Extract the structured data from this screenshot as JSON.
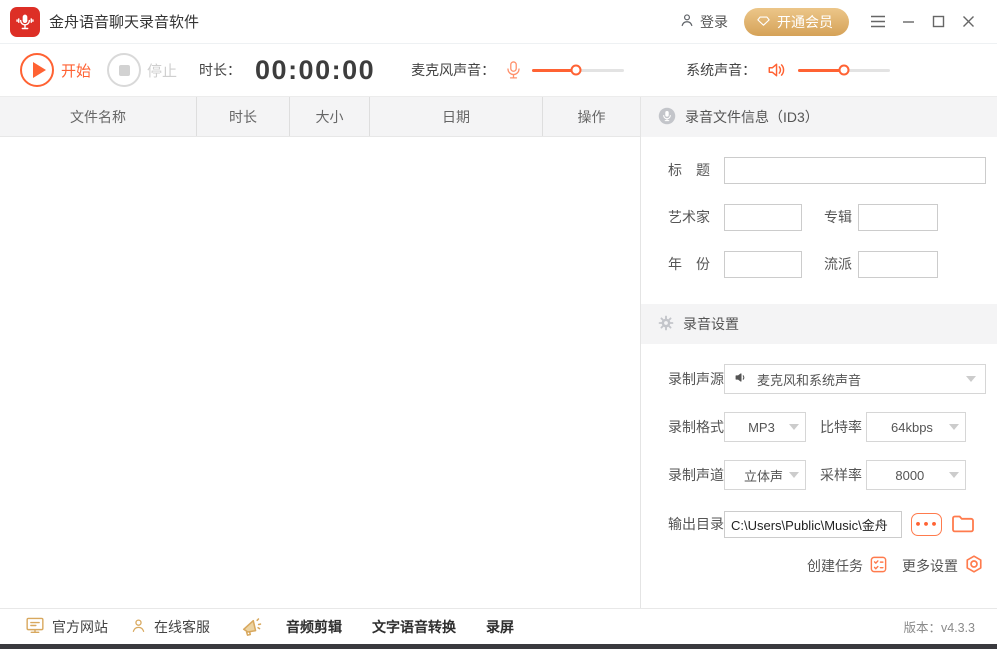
{
  "titlebar": {
    "app_title": "金舟语音聊天录音软件",
    "login_label": "登录",
    "vip_label": "开通会员"
  },
  "toolbar": {
    "start_label": "开始",
    "stop_label": "停止",
    "duration_label": "时长：",
    "timer": "00:00:00",
    "mic_label": "麦克风声音：",
    "mic_volume": 48,
    "system_label": "系统声音：",
    "system_volume": 50
  },
  "file_table": {
    "headers": [
      "文件名称",
      "时长",
      "大小",
      "日期",
      "操作"
    ],
    "rows": []
  },
  "id3_panel": {
    "header": "录音文件信息（ID3）",
    "title_label": "标　题",
    "title_value": "",
    "artist_label": "艺术家",
    "artist_value": "",
    "album_label": "专辑",
    "album_value": "",
    "year_label": "年　份",
    "year_value": "",
    "genre_label": "流派",
    "genre_value": ""
  },
  "settings_panel": {
    "header": "录音设置",
    "source_label": "录制声源",
    "source_value": "麦克风和系统声音",
    "format_label": "录制格式",
    "format_value": "MP3",
    "bitrate_label": "比特率",
    "bitrate_value": "64kbps",
    "channel_label": "录制声道",
    "channel_value": "立体声",
    "samplerate_label": "采样率",
    "samplerate_value": "8000",
    "output_label": "输出目录",
    "output_value": "C:\\Users\\Public\\Music\\金舟",
    "ellipsis_label": "•••",
    "create_task_label": "创建任务",
    "more_settings_label": "更多设置"
  },
  "footer": {
    "website_label": "官方网站",
    "support_label": "在线客服",
    "audio_edit_label": "音频剪辑",
    "tts_label": "文字语音转换",
    "screen_record_label": "录屏",
    "version_label": "版本：v4.3.3"
  },
  "colors": {
    "accent": "#ff6233",
    "gold": "#d8a85e",
    "logo_red": "#dd2f26"
  }
}
